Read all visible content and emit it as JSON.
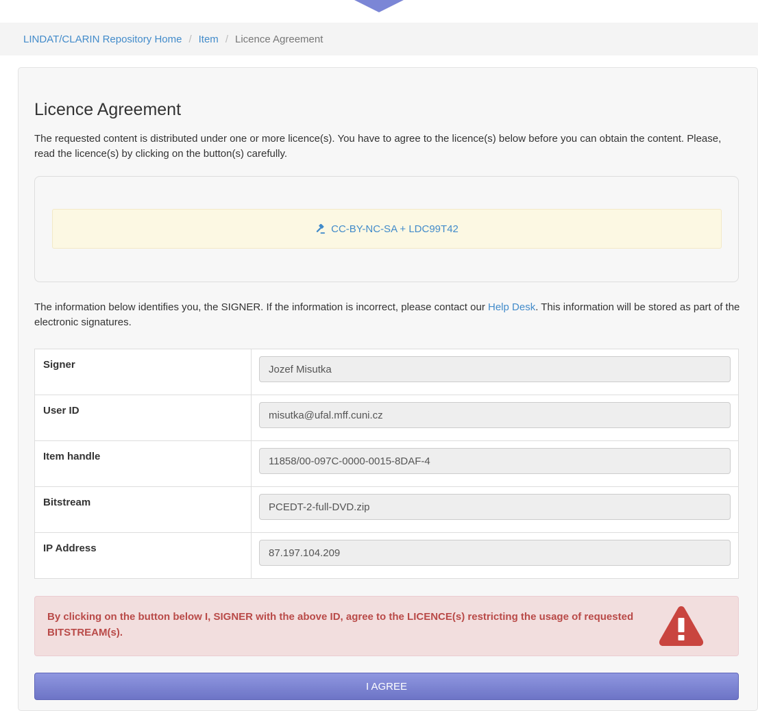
{
  "breadcrumb": {
    "home": "LINDAT/CLARIN Repository Home",
    "item": "Item",
    "current": "Licence Agreement",
    "separator": "/"
  },
  "title": "Licence Agreement",
  "intro": "The requested content is distributed under one or more licence(s). You have to agree to the licence(s) below before you can obtain the content. Please, read the licence(s) by clicking on the button(s) carefully.",
  "licence": {
    "label": "CC-BY-NC-SA + LDC99T42",
    "icon": "gavel-icon"
  },
  "info": {
    "before": "The information below identifies you, the SIGNER. If the information is incorrect, please contact our ",
    "link": "Help Desk",
    "after": ". This information will be stored as part of the electronic signatures."
  },
  "signer_table": [
    {
      "label": "Signer",
      "value": "Jozef Misutka"
    },
    {
      "label": "User ID",
      "value": "misutka@ufal.mff.cuni.cz"
    },
    {
      "label": "Item handle",
      "value": "11858/00-097C-0000-0015-8DAF-4"
    },
    {
      "label": "Bitstream",
      "value": "PCEDT-2-full-DVD.zip"
    },
    {
      "label": "IP Address",
      "value": "87.197.104.209"
    }
  ],
  "warning": {
    "text": "By clicking on the button below I, SIGNER with the above ID, agree to the LICENCE(s) restricting the usage of requested BITSTREAM(s).",
    "icon": "warning-icon"
  },
  "agree_button": "I AGREE",
  "colors": {
    "link": "#428bca",
    "warning_text": "#b94a48",
    "warning_bg": "#f2dede",
    "licence_bg": "#fcf8e3",
    "agree_button": "#7b82d1"
  }
}
